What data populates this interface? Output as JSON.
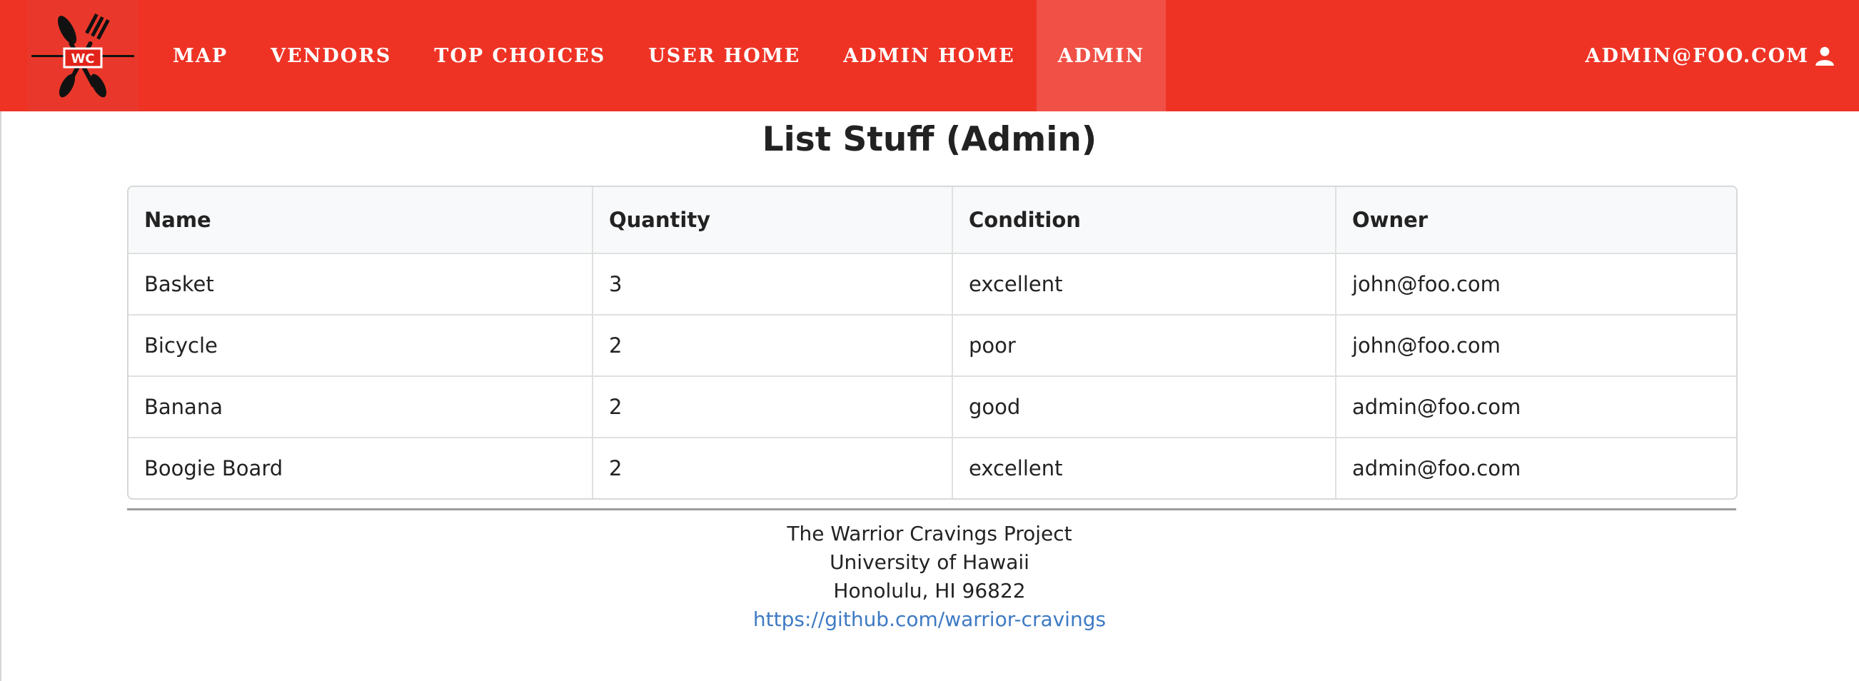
{
  "nav": {
    "logo_text": "WC",
    "items": [
      {
        "label": "Map"
      },
      {
        "label": "Vendors"
      },
      {
        "label": "Top Choices"
      },
      {
        "label": "User Home"
      },
      {
        "label": "Admin Home"
      },
      {
        "label": "Admin",
        "active": true
      }
    ],
    "user_label": "admin@foo.com",
    "user_icon": "user-icon",
    "accent_color": "#ee3325"
  },
  "page": {
    "title": "List Stuff (Admin)"
  },
  "table": {
    "columns": [
      "Name",
      "Quantity",
      "Condition",
      "Owner"
    ],
    "rows": [
      [
        "Basket",
        "3",
        "excellent",
        "john@foo.com"
      ],
      [
        "Bicycle",
        "2",
        "poor",
        "john@foo.com"
      ],
      [
        "Banana",
        "2",
        "good",
        "admin@foo.com"
      ],
      [
        "Boogie Board",
        "2",
        "excellent",
        "admin@foo.com"
      ]
    ]
  },
  "footer": {
    "line1": "The Warrior Cravings Project",
    "line2": "University of Hawaii",
    "line3": "Honolulu, HI 96822",
    "link": "https://github.com/warrior-cravings",
    "link_color": "#3e7ac4"
  }
}
